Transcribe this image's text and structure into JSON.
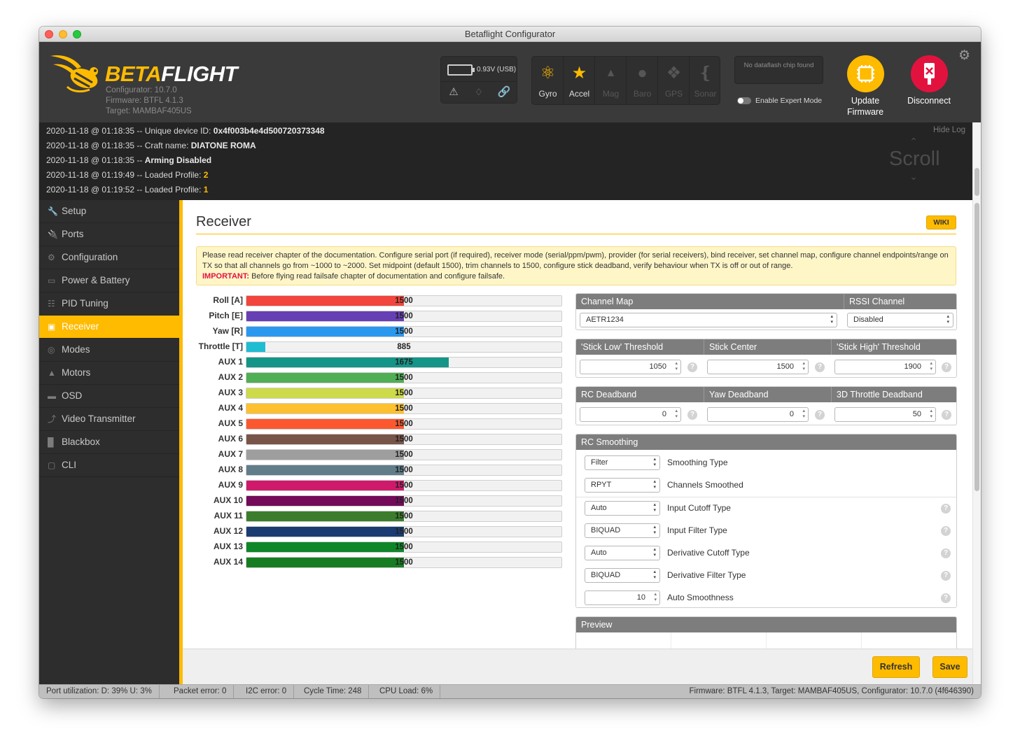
{
  "window": {
    "title": "Betaflight Configurator"
  },
  "header": {
    "brand_a": "BETA",
    "brand_b": "FLIGHT",
    "configurator": "Configurator: 10.7.0",
    "firmware": "Firmware: BTFL 4.1.3",
    "target": "Target: MAMBAF405US",
    "battery": "0.93V (USB)",
    "status_icons": [
      "warning-icon",
      "parachute-icon",
      "link-icon"
    ],
    "sensors": [
      {
        "label": "Gyro",
        "icon": "gyro-icon",
        "active": true
      },
      {
        "label": "Accel",
        "icon": "accel-icon",
        "active": true
      },
      {
        "label": "Mag",
        "icon": "mag-icon",
        "active": false
      },
      {
        "label": "Baro",
        "icon": "baro-icon",
        "active": false
      },
      {
        "label": "GPS",
        "icon": "gps-icon",
        "active": false
      },
      {
        "label": "Sonar",
        "icon": "sonar-icon",
        "active": false
      }
    ],
    "dataflash": "No dataflash chip found",
    "expert_mode": "Enable Expert Mode",
    "update_firmware": "Update Firmware",
    "disconnect": "Disconnect"
  },
  "log": {
    "hide": "Hide Log",
    "scroll": "Scroll",
    "lines": [
      {
        "prefix": "2020-11-18 @ 01:18:35 -- Unique device ID: ",
        "value": "0x4f003b4e4d500720373348",
        "hl": false
      },
      {
        "prefix": "2020-11-18 @ 01:18:35 -- Craft name: ",
        "value": "DIATONE ROMA",
        "hl": false
      },
      {
        "prefix": "2020-11-18 @ 01:18:35 -- ",
        "value": "Arming Disabled",
        "hl": false
      },
      {
        "prefix": "2020-11-18 @ 01:19:49 -- Loaded Profile: ",
        "value": "2",
        "hl": true
      },
      {
        "prefix": "2020-11-18 @ 01:19:52 -- Loaded Profile: ",
        "value": "1",
        "hl": true
      }
    ]
  },
  "sidebar": {
    "items": [
      {
        "label": "Setup",
        "icon": "wrench-icon",
        "glyph": "⚒",
        "active": false
      },
      {
        "label": "Ports",
        "icon": "plug-icon",
        "glyph": "⌁",
        "active": false
      },
      {
        "label": "Configuration",
        "icon": "gear-icon",
        "glyph": "⚙",
        "active": false
      },
      {
        "label": "Power & Battery",
        "icon": "battery-icon",
        "glyph": "▭",
        "active": false
      },
      {
        "label": "PID Tuning",
        "icon": "sitemap-icon",
        "glyph": "☷",
        "active": false
      },
      {
        "label": "Receiver",
        "icon": "remote-icon",
        "glyph": "▣",
        "active": true
      },
      {
        "label": "Modes",
        "icon": "toggle-icon",
        "glyph": "◎",
        "active": false
      },
      {
        "label": "Motors",
        "icon": "motor-icon",
        "glyph": "⚓",
        "active": false
      },
      {
        "label": "OSD",
        "icon": "osd-icon",
        "glyph": "▬",
        "active": false
      },
      {
        "label": "Video Transmitter",
        "icon": "antenna-icon",
        "glyph": "(●)",
        "active": false
      },
      {
        "label": "Blackbox",
        "icon": "blackbox-icon",
        "glyph": "▐",
        "active": false
      },
      {
        "label": "CLI",
        "icon": "terminal-icon",
        "glyph": "▢",
        "active": false
      }
    ]
  },
  "main": {
    "title": "Receiver",
    "wiki": "WIKI",
    "note_text": "Please read receiver chapter of the documentation. Configure serial port (if required), receiver mode (serial/ppm/pwm), provider (for serial receivers), bind receiver, set channel map, configure channel endpoints/range on TX so that all channels go from ~1000 to ~2000. Set midpoint (default 1500), trim channels to 1500, configure stick deadband, verify behaviour when TX is off or out of range.",
    "note_important": "IMPORTANT:",
    "note_important_text": " Before flying read failsafe chapter of documentation and configure failsafe.",
    "channel_range": [
      885,
      2115
    ],
    "channels": [
      {
        "label": "Roll [A]",
        "value": "1500",
        "color": "#f1453d"
      },
      {
        "label": "Pitch [E]",
        "value": "1500",
        "color": "#673fb4"
      },
      {
        "label": "Yaw [R]",
        "value": "1500",
        "color": "#2b98f0"
      },
      {
        "label": "Throttle [T]",
        "value": "885",
        "color": "#1fbcd2"
      },
      {
        "label": "AUX 1",
        "value": "1675",
        "color": "#159588"
      },
      {
        "label": "AUX 2",
        "value": "1500",
        "color": "#50ae55"
      },
      {
        "label": "AUX 3",
        "value": "1500",
        "color": "#cdda49"
      },
      {
        "label": "AUX 4",
        "value": "1500",
        "color": "#fdc02f"
      },
      {
        "label": "AUX 5",
        "value": "1500",
        "color": "#fc5830"
      },
      {
        "label": "AUX 6",
        "value": "1500",
        "color": "#785549"
      },
      {
        "label": "AUX 7",
        "value": "1500",
        "color": "#9e9e9e"
      },
      {
        "label": "AUX 8",
        "value": "1500",
        "color": "#617d8a"
      },
      {
        "label": "AUX 9",
        "value": "1500",
        "color": "#cf1a6c"
      },
      {
        "label": "AUX 10",
        "value": "1500",
        "color": "#730b5a"
      },
      {
        "label": "AUX 11",
        "value": "1500",
        "color": "#3b7d2c"
      },
      {
        "label": "AUX 12",
        "value": "1500",
        "color": "#1b3c72"
      },
      {
        "label": "AUX 13",
        "value": "1500",
        "color": "#0e8628"
      },
      {
        "label": "AUX 14",
        "value": "1500",
        "color": "#177d22"
      }
    ],
    "channel_map": {
      "header": "Channel Map",
      "value": "AETR1234"
    },
    "rssi": {
      "header": "RSSI Channel",
      "value": "Disabled"
    },
    "thresholds": {
      "low_header": "'Stick Low' Threshold",
      "low": "1050",
      "center_header": "Stick Center",
      "center": "1500",
      "high_header": "'Stick High' Threshold",
      "high": "1900"
    },
    "deadband": {
      "rc_header": "RC Deadband",
      "rc": "0",
      "yaw_header": "Yaw Deadband",
      "yaw": "0",
      "throttle3d_header": "3D Throttle Deadband",
      "throttle3d": "50"
    },
    "smoothing": {
      "header": "RC Smoothing",
      "type": {
        "value": "Filter",
        "label": "Smoothing Type"
      },
      "channels": {
        "value": "RPYT",
        "label": "Channels Smoothed"
      },
      "input_cutoff": {
        "value": "Auto",
        "label": "Input Cutoff Type"
      },
      "input_filter": {
        "value": "BIQUAD",
        "label": "Input Filter Type"
      },
      "deriv_cutoff": {
        "value": "Auto",
        "label": "Derivative Cutoff Type"
      },
      "deriv_filter": {
        "value": "BIQUAD",
        "label": "Derivative Filter Type"
      },
      "auto_smooth": {
        "value": "10",
        "label": "Auto Smoothness"
      }
    },
    "preview": {
      "header": "Preview"
    },
    "refresh": "Refresh",
    "save": "Save"
  },
  "status_bar": {
    "port": "Port utilization: D: 39% U: 3%",
    "packet": "Packet error: 0",
    "i2c": "I2C error: 0",
    "cycle": "Cycle Time: 248",
    "cpu": "CPU Load: 6%",
    "right": "Firmware: BTFL 4.1.3, Target: MAMBAF405US, Configurator: 10.7.0 (4f646390)"
  }
}
